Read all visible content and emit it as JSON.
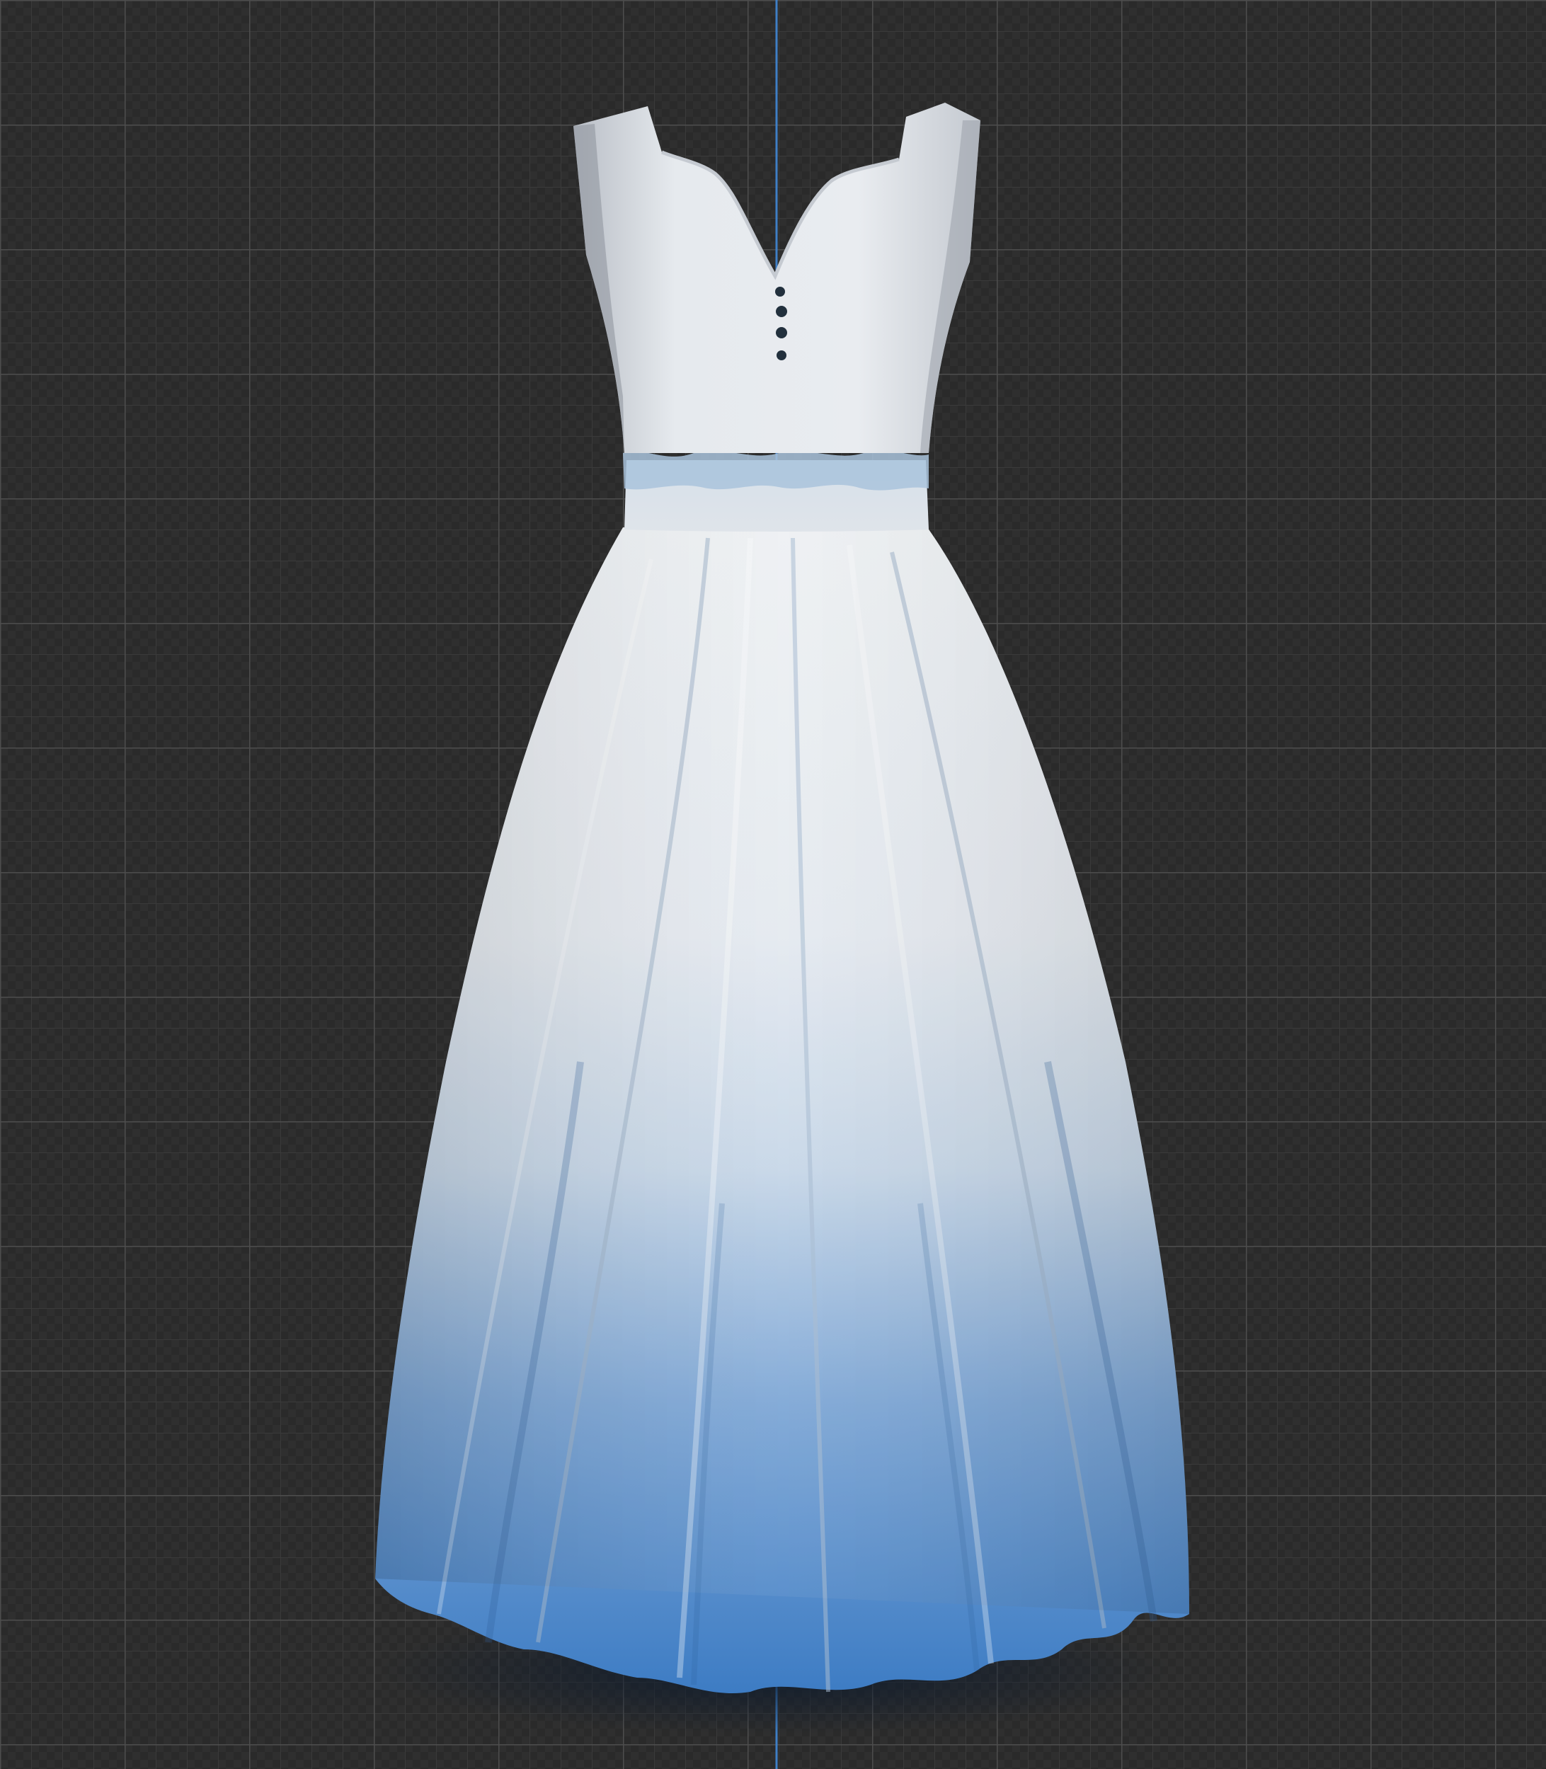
{
  "viewport": {
    "background_color": "#2a2a2a",
    "checker_color": "#2f2f2f",
    "minor_grid_color": "#3a3a3a",
    "major_grid_color": "#4d4d4d",
    "axis_color": "#3f7fc6"
  },
  "garment": {
    "bodice_color": "#e6eaee",
    "bodice_shadow_color": "#b9bec6",
    "waistband_color": "#dfe4ea",
    "waist_trim_color": "#a9c3dc",
    "skirt_top_color": "#eef1f4",
    "skirt_mid_color": "#c7d7e8",
    "skirt_bottom_color": "#3d7cc4",
    "button_color": "#22303d",
    "button_count": 4
  }
}
